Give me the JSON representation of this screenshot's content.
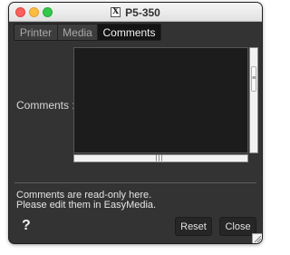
{
  "window": {
    "title": "P5-350",
    "app_icon": "x11-icon"
  },
  "tabs": [
    {
      "label": "Printer",
      "selected": false
    },
    {
      "label": "Media",
      "selected": false
    },
    {
      "label": "Comments",
      "selected": true
    }
  ],
  "comments_field": {
    "label": "Comments  :",
    "value": ""
  },
  "info": {
    "line1": "Comments are read-only here.",
    "line2": "Please edit them in EasyMedia."
  },
  "buttons": {
    "help": "?",
    "reset": "Reset",
    "close": "Close"
  },
  "colors": {
    "background": "#333333",
    "selected_tab": "#141414",
    "textarea": "#1c1c1c"
  }
}
